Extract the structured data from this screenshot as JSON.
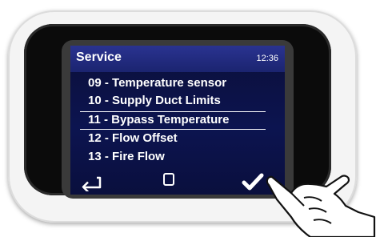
{
  "screen": {
    "title": "Service",
    "time": "12:36",
    "menu_items": [
      {
        "label": "09 - Temperature sensor"
      },
      {
        "label": "10 - Supply Duct Limits"
      },
      {
        "label": "11 - Bypass Temperature",
        "selected": true
      },
      {
        "label": "12 - Flow Offset"
      },
      {
        "label": "13 - Fire Flow"
      }
    ]
  },
  "footer": {
    "back_icon": "back-arrow-icon",
    "home_icon": "square-icon",
    "confirm_icon": "checkmark-icon"
  },
  "colors": {
    "screen_bg": "#0c1450",
    "header_bg": "#2a3390",
    "text": "#ffffff",
    "device_body": "#f4f4f4"
  }
}
